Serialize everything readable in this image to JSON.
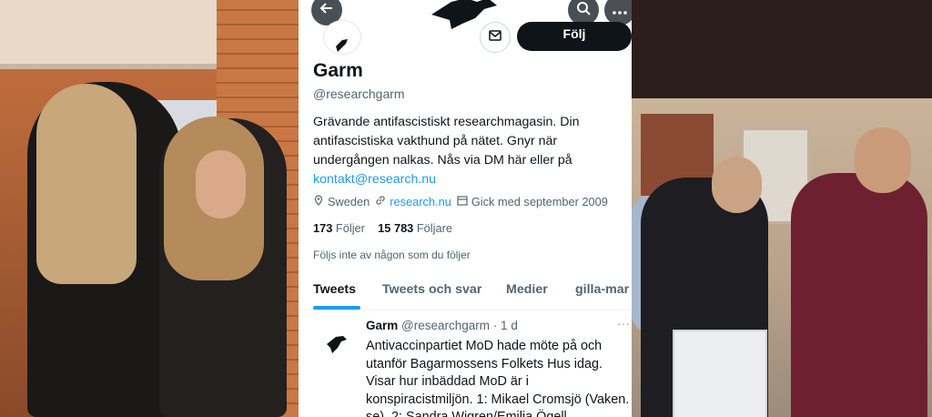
{
  "profile": {
    "follow_label": "Följ",
    "name": "Garm",
    "handle": "@researchgarm",
    "bio_text": "Grävande antifascistiskt researchmagasin. Din antifascistiska vakthund på nätet. Gnyr när undergången nalkas. Nås via DM här eller på ",
    "bio_link": "kontakt@research.nu",
    "location": "Sweden",
    "website": "research.nu",
    "joined": "Gick med september 2009",
    "following_count": "173",
    "following_label": "Följer",
    "followers_count": "15 783",
    "followers_label": "Följare",
    "followed_by": "Följs inte av någon som du följer"
  },
  "tabs": [
    "Tweets",
    "Tweets och svar",
    "Medier",
    "gilla-mar"
  ],
  "tweet": {
    "name": "Garm",
    "handle": "@researchgarm",
    "time": "· 1 d",
    "more": "···",
    "text": "Antivaccinpartiet MoD hade möte på och utanför Bagarmossens Folkets Hus idag. Visar hur inbäddad MoD är i konspiracistmiljön. 1: Mikael Cromsjö (Vaken. se), 2: Sandra Wigren/Emilia Ögell"
  },
  "colors": {
    "accent": "#1d9bf0",
    "text": "#0f1419",
    "muted": "#536471"
  },
  "icons": [
    "back-arrow-icon",
    "search-icon",
    "more-icon",
    "mail-icon",
    "location-icon",
    "link-icon",
    "calendar-icon",
    "raven-logo"
  ]
}
